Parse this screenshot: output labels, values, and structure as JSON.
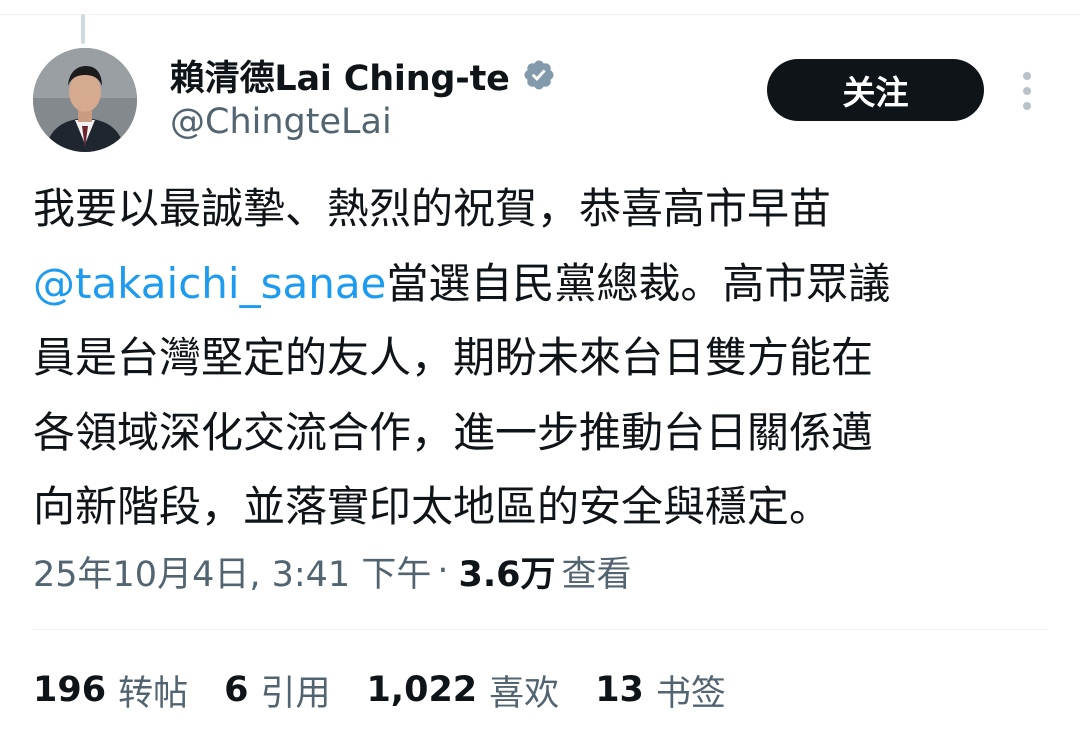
{
  "author": {
    "display_name": "賴清德Lai Ching-te",
    "handle": "@ChingteLai",
    "verified_icon": "verified-badge-icon",
    "avatar_icon": "profile-photo"
  },
  "follow_button": {
    "label": "关注"
  },
  "more_menu": {
    "icon": "more-vertical-icon"
  },
  "tweet": {
    "line1": "我要以最誠摯、熱烈的祝賀，恭喜高市早苗",
    "mention": "@takaichi_sanae",
    "line2_rest": "當選自民黨總裁。高市眾議",
    "line3": "員是台灣堅定的友人，期盼未來台日雙方能在",
    "line4": "各領域深化交流合作，進一步推動台日關係邁",
    "line5": "向新階段，並落實印太地區的安全與穩定。"
  },
  "meta": {
    "timestamp": "25年10月4日, 3:41 下午",
    "separator": "·",
    "views_count": "3.6万",
    "views_label": "查看"
  },
  "stats": {
    "reposts": {
      "count": "196",
      "label": "转帖"
    },
    "quotes": {
      "count": "6",
      "label": "引用"
    },
    "likes": {
      "count": "1,022",
      "label": "喜欢"
    },
    "bookmarks": {
      "count": "13",
      "label": "书签"
    }
  },
  "colors": {
    "text": "#0f1419",
    "secondary": "#536471",
    "link": "#1d9bf0",
    "button_bg": "#0f1419",
    "verified": "#829aab"
  }
}
